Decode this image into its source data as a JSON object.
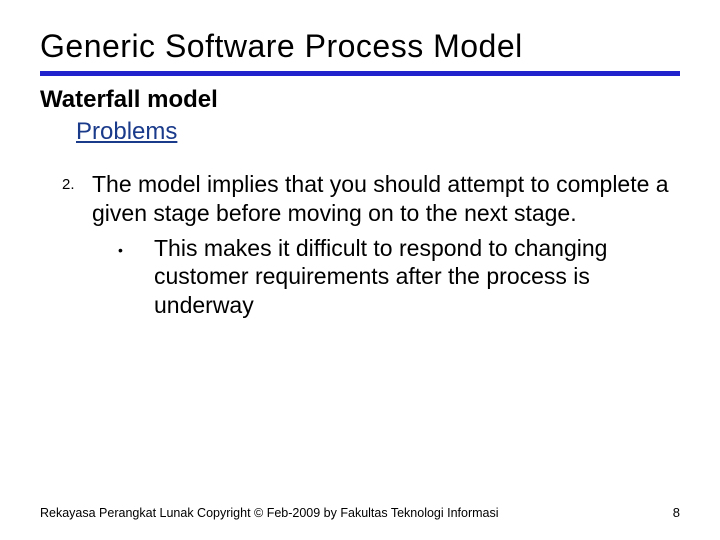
{
  "title": "Generic Software Process Model",
  "subtitle": "Waterfall model",
  "section": "Problems",
  "list": {
    "number": "2.",
    "text": "The model implies that you should attempt to complete a given stage before moving on to the next stage.",
    "sub_bullet": "•",
    "sub_text": "This makes it difficult to respond to changing customer requirements after the process is underway"
  },
  "footer": {
    "copyright": "Rekayasa Perangkat Lunak Copyright © Feb-2009 by Fakultas Teknologi Informasi",
    "page": "8"
  }
}
